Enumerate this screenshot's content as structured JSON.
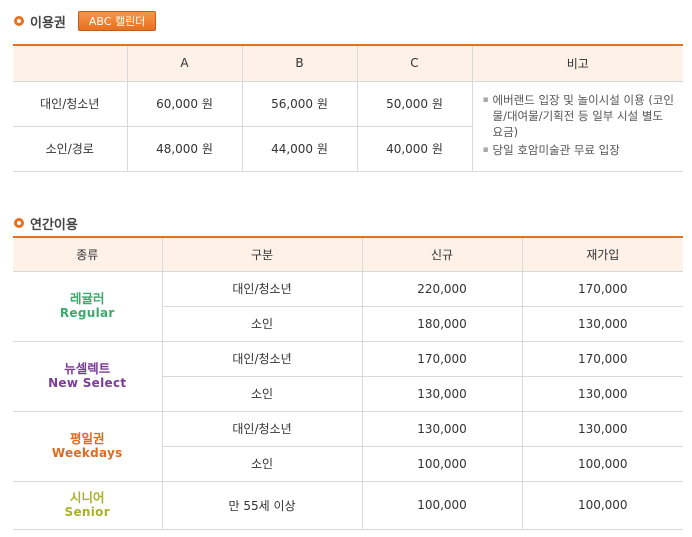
{
  "tickets": {
    "title": "이용권",
    "calendar_button": "ABC 캘린더",
    "headers": [
      "",
      "A",
      "B",
      "C",
      "비고"
    ],
    "rows": [
      {
        "label": "대인/청소년",
        "a": "60,000 원",
        "b": "56,000 원",
        "c": "50,000 원"
      },
      {
        "label": "소인/경로",
        "a": "48,000 원",
        "b": "44,000 원",
        "c": "40,000 원"
      }
    ],
    "notes": [
      "에버랜드 입장 및 놀이시설 이용 (코인물/대여물/기획전 등 일부 시설 별도 요금)",
      "당일 호암미술관 무료 입장"
    ]
  },
  "annual": {
    "title": "연간이용",
    "headers": [
      "종류",
      "구분",
      "신규",
      "재가입"
    ],
    "groups": [
      {
        "ko": "레귤러",
        "en": "Regular",
        "color": "#3caa6e",
        "rows": [
          {
            "cat": "대인/청소년",
            "new": "220,000",
            "re": "170,000"
          },
          {
            "cat": "소인",
            "new": "180,000",
            "re": "130,000"
          }
        ]
      },
      {
        "ko": "뉴셀렉트",
        "en": "New Select",
        "color": "#7a3c96",
        "rows": [
          {
            "cat": "대인/청소년",
            "new": "170,000",
            "re": "170,000"
          },
          {
            "cat": "소인",
            "new": "130,000",
            "re": "130,000"
          }
        ]
      },
      {
        "ko": "평일권",
        "en": "Weekdays",
        "color": "#e06a1e",
        "rows": [
          {
            "cat": "대인/청소년",
            "new": "130,000",
            "re": "130,000"
          },
          {
            "cat": "소인",
            "new": "100,000",
            "re": "100,000"
          }
        ]
      },
      {
        "ko": "시니어",
        "en": "Senior",
        "color": "#a8b22a",
        "rows": [
          {
            "cat": "만 55세 이상",
            "new": "100,000",
            "re": "100,000"
          }
        ]
      }
    ]
  },
  "colors": {
    "accent": "#e8711f",
    "header_bg": "#fdf1e8"
  }
}
